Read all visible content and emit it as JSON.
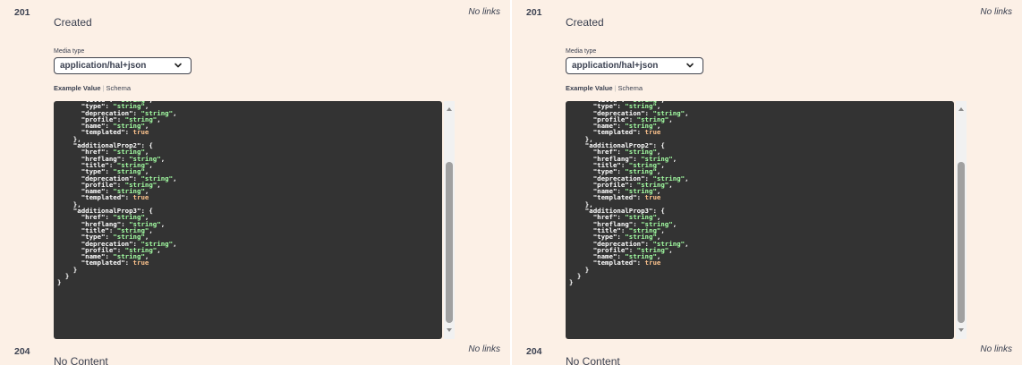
{
  "panels": [
    {
      "created_code": "201",
      "created_desc": "Created",
      "created_links": "No links",
      "media_type_label": "Media type",
      "media_type_value": "application/hal+json",
      "tab_example": "Example Value",
      "tab_schema": "Schema",
      "code_lines": [
        [
          [
            "k",
            "      \"title\": "
          ],
          [
            "s",
            "\"string\""
          ],
          [
            "k",
            ","
          ]
        ],
        [
          [
            "k",
            "      \"type\": "
          ],
          [
            "s",
            "\"string\""
          ],
          [
            "k",
            ","
          ]
        ],
        [
          [
            "k",
            "      \"deprecation\": "
          ],
          [
            "s",
            "\"string\""
          ],
          [
            "k",
            ","
          ]
        ],
        [
          [
            "k",
            "      \"profile\": "
          ],
          [
            "s",
            "\"string\""
          ],
          [
            "k",
            ","
          ]
        ],
        [
          [
            "k",
            "      \"name\": "
          ],
          [
            "s",
            "\"string\""
          ],
          [
            "k",
            ","
          ]
        ],
        [
          [
            "k",
            "      \"templated\": "
          ],
          [
            "b",
            "true"
          ]
        ],
        [
          [
            "k",
            "    },"
          ]
        ],
        [
          [
            "k",
            "    \"additionalProp2\": {"
          ]
        ],
        [
          [
            "k",
            "      \"href\": "
          ],
          [
            "s",
            "\"string\""
          ],
          [
            "k",
            ","
          ]
        ],
        [
          [
            "k",
            "      \"hreflang\": "
          ],
          [
            "s",
            "\"string\""
          ],
          [
            "k",
            ","
          ]
        ],
        [
          [
            "k",
            "      \"title\": "
          ],
          [
            "s",
            "\"string\""
          ],
          [
            "k",
            ","
          ]
        ],
        [
          [
            "k",
            "      \"type\": "
          ],
          [
            "s",
            "\"string\""
          ],
          [
            "k",
            ","
          ]
        ],
        [
          [
            "k",
            "      \"deprecation\": "
          ],
          [
            "s",
            "\"string\""
          ],
          [
            "k",
            ","
          ]
        ],
        [
          [
            "k",
            "      \"profile\": "
          ],
          [
            "s",
            "\"string\""
          ],
          [
            "k",
            ","
          ]
        ],
        [
          [
            "k",
            "      \"name\": "
          ],
          [
            "s",
            "\"string\""
          ],
          [
            "k",
            ","
          ]
        ],
        [
          [
            "k",
            "      \"templated\": "
          ],
          [
            "b",
            "true"
          ]
        ],
        [
          [
            "k",
            "    },"
          ]
        ],
        [
          [
            "k",
            "    \"additionalProp3\": {"
          ]
        ],
        [
          [
            "k",
            "      \"href\": "
          ],
          [
            "s",
            "\"string\""
          ],
          [
            "k",
            ","
          ]
        ],
        [
          [
            "k",
            "      \"hreflang\": "
          ],
          [
            "s",
            "\"string\""
          ],
          [
            "k",
            ","
          ]
        ],
        [
          [
            "k",
            "      \"title\": "
          ],
          [
            "s",
            "\"string\""
          ],
          [
            "k",
            ","
          ]
        ],
        [
          [
            "k",
            "      \"type\": "
          ],
          [
            "s",
            "\"string\""
          ],
          [
            "k",
            ","
          ]
        ],
        [
          [
            "k",
            "      \"deprecation\": "
          ],
          [
            "s",
            "\"string\""
          ],
          [
            "k",
            ","
          ]
        ],
        [
          [
            "k",
            "      \"profile\": "
          ],
          [
            "s",
            "\"string\""
          ],
          [
            "k",
            ","
          ]
        ],
        [
          [
            "k",
            "      \"name\": "
          ],
          [
            "s",
            "\"string\""
          ],
          [
            "k",
            ","
          ]
        ],
        [
          [
            "k",
            "      \"templated\": "
          ],
          [
            "b",
            "true"
          ]
        ],
        [
          [
            "k",
            "    }"
          ]
        ],
        [
          [
            "k",
            "  }"
          ]
        ],
        [
          [
            "k",
            "}"
          ]
        ]
      ],
      "nocontent_code": "204",
      "nocontent_desc": "No Content",
      "nocontent_links": "No links"
    },
    {
      "created_code": "201",
      "created_desc": "Created",
      "created_links": "No links",
      "media_type_label": "Media type",
      "media_type_value": "application/hal+json",
      "tab_example": "Example Value",
      "tab_schema": "Schema",
      "code_lines": [
        [
          [
            "k",
            "      \"title\": "
          ],
          [
            "s",
            "\"string\""
          ],
          [
            "k",
            ","
          ]
        ],
        [
          [
            "k",
            "      \"type\": "
          ],
          [
            "s",
            "\"string\""
          ],
          [
            "k",
            ","
          ]
        ],
        [
          [
            "k",
            "      \"deprecation\": "
          ],
          [
            "s",
            "\"string\""
          ],
          [
            "k",
            ","
          ]
        ],
        [
          [
            "k",
            "      \"profile\": "
          ],
          [
            "s",
            "\"string\""
          ],
          [
            "k",
            ","
          ]
        ],
        [
          [
            "k",
            "      \"name\": "
          ],
          [
            "s",
            "\"string\""
          ],
          [
            "k",
            ","
          ]
        ],
        [
          [
            "k",
            "      \"templated\": "
          ],
          [
            "b",
            "true"
          ]
        ],
        [
          [
            "k",
            "    },"
          ]
        ],
        [
          [
            "k",
            "    \"additionalProp2\": {"
          ]
        ],
        [
          [
            "k",
            "      \"href\": "
          ],
          [
            "s",
            "\"string\""
          ],
          [
            "k",
            ","
          ]
        ],
        [
          [
            "k",
            "      \"hreflang\": "
          ],
          [
            "s",
            "\"string\""
          ],
          [
            "k",
            ","
          ]
        ],
        [
          [
            "k",
            "      \"title\": "
          ],
          [
            "s",
            "\"string\""
          ],
          [
            "k",
            ","
          ]
        ],
        [
          [
            "k",
            "      \"type\": "
          ],
          [
            "s",
            "\"string\""
          ],
          [
            "k",
            ","
          ]
        ],
        [
          [
            "k",
            "      \"deprecation\": "
          ],
          [
            "s",
            "\"string\""
          ],
          [
            "k",
            ","
          ]
        ],
        [
          [
            "k",
            "      \"profile\": "
          ],
          [
            "s",
            "\"string\""
          ],
          [
            "k",
            ","
          ]
        ],
        [
          [
            "k",
            "      \"name\": "
          ],
          [
            "s",
            "\"string\""
          ],
          [
            "k",
            ","
          ]
        ],
        [
          [
            "k",
            "      \"templated\": "
          ],
          [
            "b",
            "true"
          ]
        ],
        [
          [
            "k",
            "    },"
          ]
        ],
        [
          [
            "k",
            "    \"additionalProp3\": {"
          ]
        ],
        [
          [
            "k",
            "      \"href\": "
          ],
          [
            "s",
            "\"string\""
          ],
          [
            "k",
            ","
          ]
        ],
        [
          [
            "k",
            "      \"hreflang\": "
          ],
          [
            "s",
            "\"string\""
          ],
          [
            "k",
            ","
          ]
        ],
        [
          [
            "k",
            "      \"title\": "
          ],
          [
            "s",
            "\"string\""
          ],
          [
            "k",
            ","
          ]
        ],
        [
          [
            "k",
            "      \"type\": "
          ],
          [
            "s",
            "\"string\""
          ],
          [
            "k",
            ","
          ]
        ],
        [
          [
            "k",
            "      \"deprecation\": "
          ],
          [
            "s",
            "\"string\""
          ],
          [
            "k",
            ","
          ]
        ],
        [
          [
            "k",
            "      \"profile\": "
          ],
          [
            "s",
            "\"string\""
          ],
          [
            "k",
            ","
          ]
        ],
        [
          [
            "k",
            "      \"name\": "
          ],
          [
            "s",
            "\"string\""
          ],
          [
            "k",
            ","
          ]
        ],
        [
          [
            "k",
            "      \"templated\": "
          ],
          [
            "b",
            "true"
          ]
        ],
        [
          [
            "k",
            "    }"
          ]
        ],
        [
          [
            "k",
            "  }"
          ]
        ],
        [
          [
            "k",
            "}"
          ]
        ]
      ],
      "nocontent_code": "204",
      "nocontent_desc": "No Content",
      "nocontent_links": "No links"
    }
  ],
  "colors": {
    "panel_bg": "#fcf0e6",
    "code_bg": "#333333",
    "code_key": "#ffffff",
    "code_string": "#a2fca2",
    "code_boolean": "#fcc28c",
    "text": "#3b4151"
  },
  "icons": {
    "select": "chevron-down-icon",
    "scroll_up": "triangle-up-icon",
    "scroll_down": "triangle-down-icon"
  }
}
